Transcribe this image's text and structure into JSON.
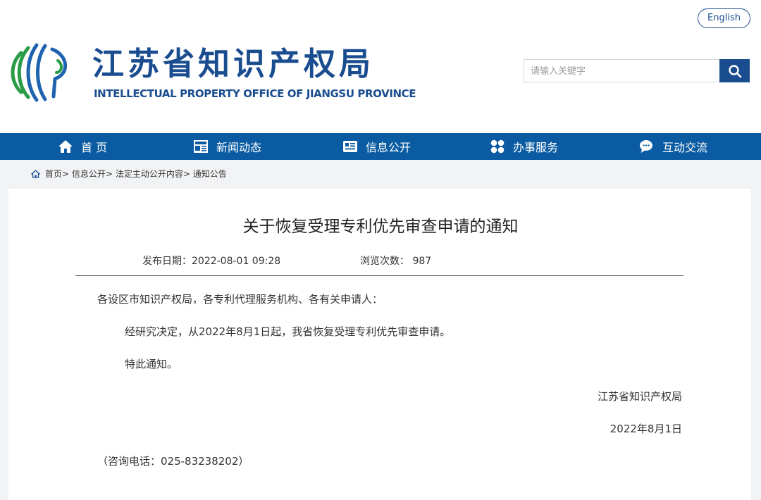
{
  "header": {
    "lang_button": "English",
    "org_name_cn": "江苏省知识产权局",
    "org_name_en": "INTELLECTUAL PROPERTY OFFICE OF JIANGSU PROVINCE",
    "search_placeholder": "请输入关键字",
    "logo_icon": "jiangsu-ipo-emblem",
    "search_icon": "magnifier"
  },
  "nav": {
    "items": [
      {
        "label": "首 页",
        "icon": "home-icon"
      },
      {
        "label": "新闻动态",
        "icon": "news-icon"
      },
      {
        "label": "信息公开",
        "icon": "info-icon"
      },
      {
        "label": "办事服务",
        "icon": "service-icon"
      },
      {
        "label": "互动交流",
        "icon": "chat-icon"
      }
    ]
  },
  "breadcrumb": {
    "items": [
      "首页",
      "信息公开",
      "法定主动公开内容",
      "通知公告"
    ],
    "separator": ">"
  },
  "article": {
    "title": "关于恢复受理专利优先审查申请的通知",
    "publish_label": "发布日期：",
    "publish_date": "2022-08-01 09:28",
    "views_label": "浏览次数：",
    "views": "987",
    "salutation": "各设区市知识产权局，各专利代理服务机构、各有关申请人：",
    "body": "经研究决定，从2022年8月1日起，我省恢复受理专利优先审查申请。",
    "closing": "特此通知。",
    "signature": "江苏省知识产权局",
    "sign_date": "2022年8月1日",
    "contact": "（咨询电话：025-83238202）"
  },
  "colors": {
    "brand_blue": "#1a4d8f",
    "nav_blue": "#0a5ba1",
    "logo_green": "#2a9b47",
    "logo_blue": "#1e63b0"
  }
}
